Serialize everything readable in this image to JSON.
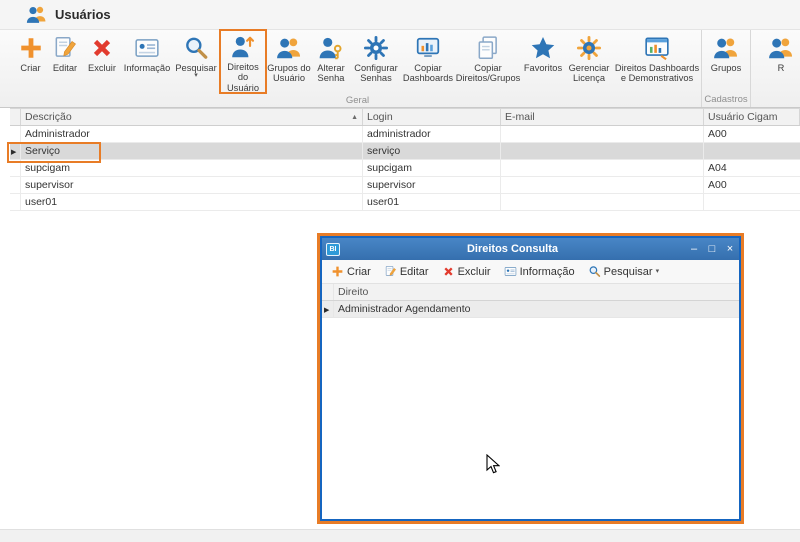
{
  "header": {
    "title": "Usuários"
  },
  "ribbon": {
    "groups": [
      {
        "label": "Geral",
        "items": [
          {
            "label": "Criar"
          },
          {
            "label": "Editar"
          },
          {
            "label": "Excluir"
          },
          {
            "label": "Informação"
          },
          {
            "label": "Pesquisar"
          },
          {
            "label": "Direitos do Usuário"
          },
          {
            "label": "Grupos do Usuário"
          },
          {
            "label": "Alterar Senha"
          },
          {
            "label": "Configurar Senhas"
          },
          {
            "label": "Copiar Dashboards"
          },
          {
            "label": "Copiar Direitos/Grupos"
          },
          {
            "label": "Favoritos"
          },
          {
            "label": "Gerenciar Licença"
          },
          {
            "label": "Direitos Dashboards e Demonstrativos"
          }
        ]
      },
      {
        "label": "Cadastros",
        "items": [
          {
            "label": "Grupos"
          }
        ]
      },
      {
        "label": "",
        "items": [
          {
            "label": "R"
          }
        ]
      }
    ]
  },
  "grid": {
    "columns": {
      "descricao": "Descrição",
      "login": "Login",
      "email": "E-mail",
      "usuario_cigam": "Usuário Cigam"
    },
    "sort": {
      "column": "Descrição",
      "direction": "asc"
    },
    "rows": [
      {
        "descricao": "Administrador",
        "login": "administrador",
        "email": "",
        "usuario_cigam": "A00"
      },
      {
        "descricao": "Serviço",
        "login": "serviço",
        "email": "",
        "usuario_cigam": ""
      },
      {
        "descricao": "supcigam",
        "login": "supcigam",
        "email": "",
        "usuario_cigam": "A04"
      },
      {
        "descricao": "supervisor",
        "login": "supervisor",
        "email": "",
        "usuario_cigam": "A00"
      },
      {
        "descricao": "user01",
        "login": "user01",
        "email": "",
        "usuario_cigam": ""
      }
    ],
    "selected_row": "Serviço"
  },
  "dialog": {
    "title": "Direitos Consulta",
    "app_icon_text": "BI",
    "toolbar": [
      {
        "label": "Criar"
      },
      {
        "label": "Editar"
      },
      {
        "label": "Excluir"
      },
      {
        "label": "Informação"
      },
      {
        "label": "Pesquisar"
      }
    ],
    "grid": {
      "column": "Direito",
      "rows": [
        {
          "direito": "Administrador Agendamento"
        }
      ],
      "selected_row": "Administrador Agendamento"
    }
  },
  "icons": {
    "sort_asc": "▲",
    "row_marker": "▶",
    "dropdown": "▾",
    "minimize": "–",
    "maximize": "□",
    "close": "×"
  },
  "colors": {
    "annotation_orange": "#e87c26",
    "titlebar_blue": "#3d79bd",
    "accent_blue": "#2e75b6",
    "accent_orange": "#f0912d",
    "delete_red": "#e23b2e"
  }
}
